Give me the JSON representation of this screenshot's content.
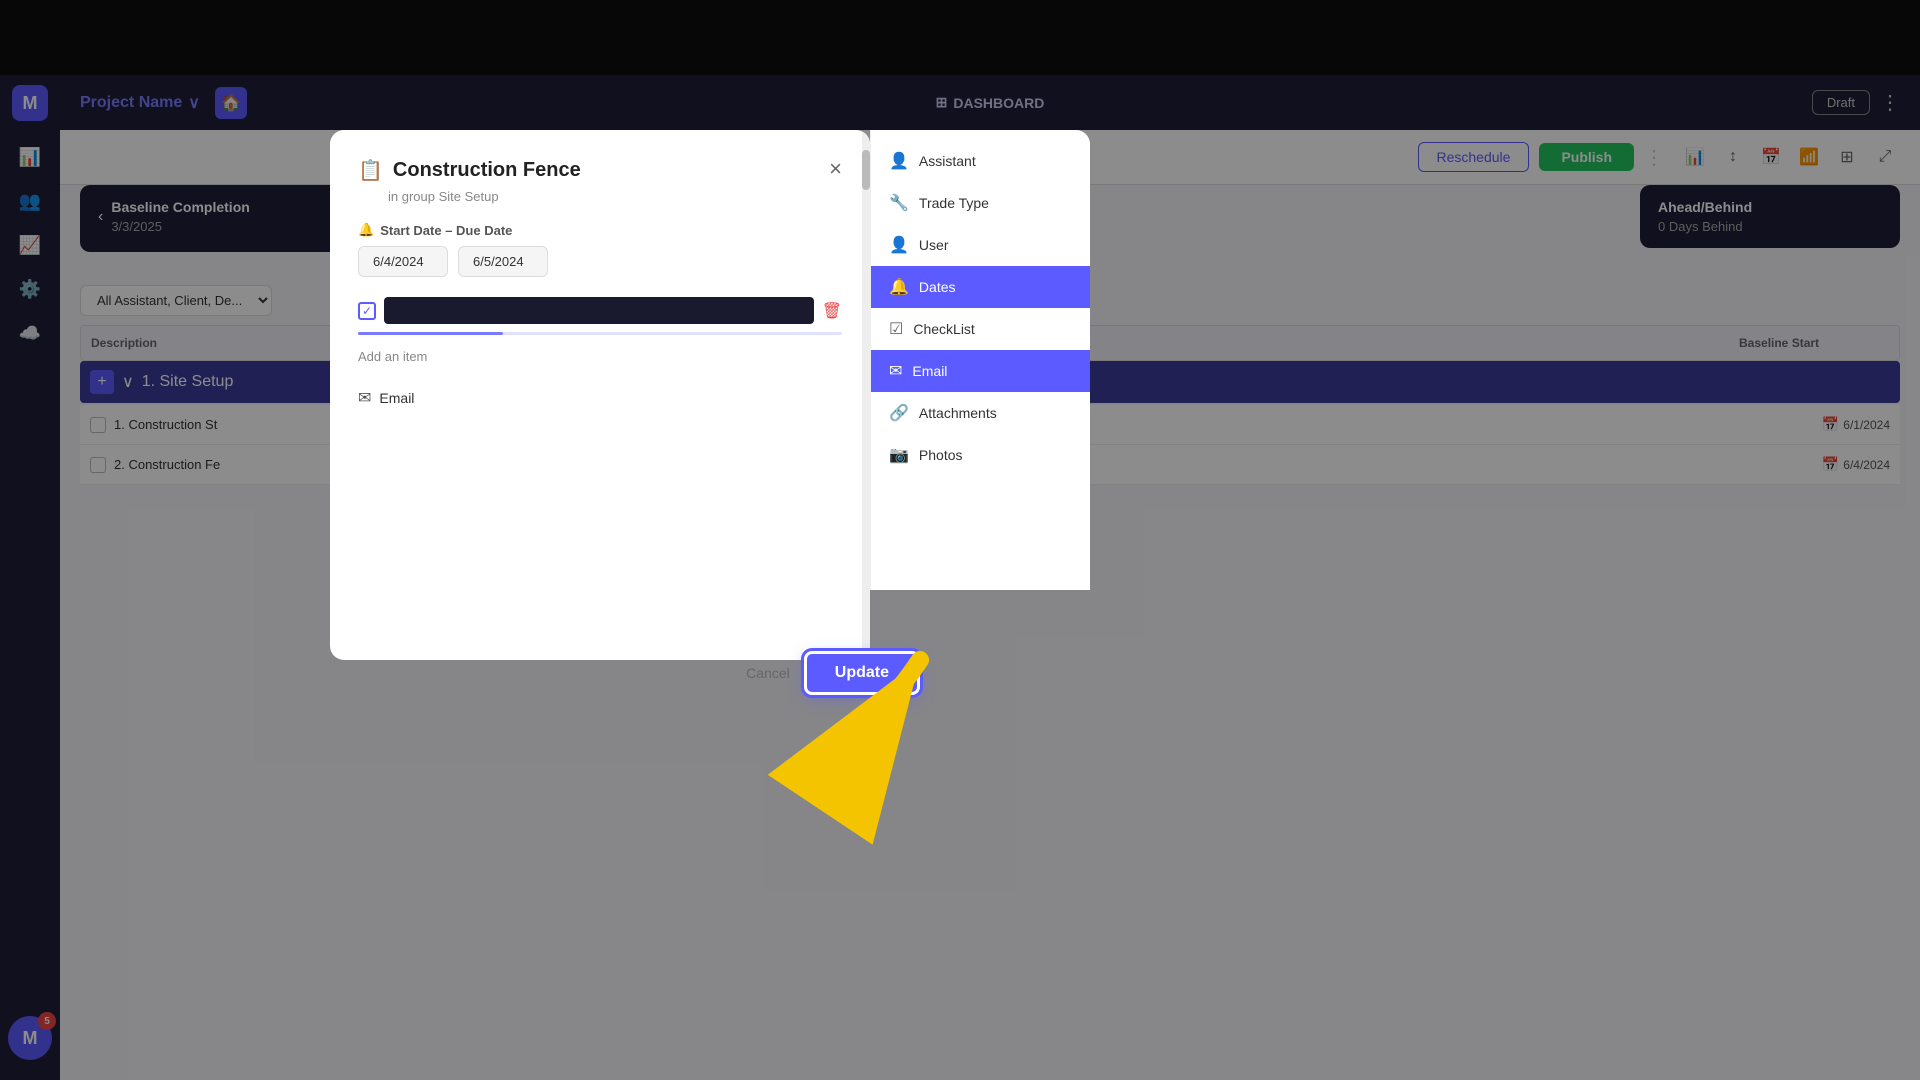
{
  "app": {
    "title": "M",
    "logo_char": "M"
  },
  "topbar": {},
  "nav": {
    "project_name": "Project Name",
    "home_icon": "🏠",
    "dashboard_icon": "⊞",
    "dashboard_label": "DASHBOARD",
    "draft_btn": "Draft",
    "more_icon": "⋮"
  },
  "toolbar": {
    "reschedule_btn": "Reschedule",
    "publish_btn": "Publish",
    "more_icon": "⋮"
  },
  "cards": {
    "baseline": {
      "title": "Baseline Completion",
      "date": "3/3/2025"
    },
    "ahead_behind": {
      "title": "Ahead/Behind",
      "value": "0 Days Behind"
    }
  },
  "filter": {
    "label": "All Assistant, Client, De...",
    "chevron": "∨"
  },
  "table": {
    "columns": {
      "description": "Description",
      "baseline_start": "Baseline Start"
    },
    "groups": [
      {
        "name": "1. Site Setup",
        "tasks": [
          {
            "id": "1",
            "name": "1. Construction St",
            "date": "6/1/2024",
            "has_calendar": true
          },
          {
            "id": "2",
            "name": "2. Construction Fe",
            "date": "6/4/2024",
            "has_calendar": true
          }
        ]
      }
    ]
  },
  "sidebar": {
    "icons": [
      "📊",
      "👥",
      "📈",
      "⚙️",
      "☁️"
    ]
  },
  "avatar": {
    "char": "M",
    "badge_count": "5"
  },
  "modal": {
    "icon": "📋",
    "title": "Construction Fence",
    "subtitle": "in group Site Setup",
    "close_icon": "×",
    "date_section": {
      "label": "Start Date – Due Date",
      "bell_icon": "🔔",
      "start_date": "6/4/2024",
      "end_date": "6/5/2024"
    },
    "checklist": {
      "items": [
        {
          "checked": true,
          "text": "",
          "show_delete": true
        }
      ],
      "add_label": "Add an item",
      "progress": 30
    },
    "email_section": {
      "icon": "✉",
      "label": "Email"
    },
    "actions": {
      "cancel_label": "Cancel",
      "update_label": "Update"
    }
  },
  "right_panel": {
    "items": [
      {
        "icon": "👤",
        "label": "Assistant",
        "active": false
      },
      {
        "icon": "🔧",
        "label": "Trade Type",
        "active": false
      },
      {
        "icon": "👤",
        "label": "User",
        "active": false
      },
      {
        "icon": "🔔",
        "label": "Dates",
        "active": true
      },
      {
        "icon": "☑",
        "label": "CheckList",
        "active": false
      },
      {
        "icon": "✉",
        "label": "Email",
        "active": true
      },
      {
        "icon": "🔗",
        "label": "Attachments",
        "active": false
      },
      {
        "icon": "📷",
        "label": "Photos",
        "active": false
      }
    ]
  }
}
